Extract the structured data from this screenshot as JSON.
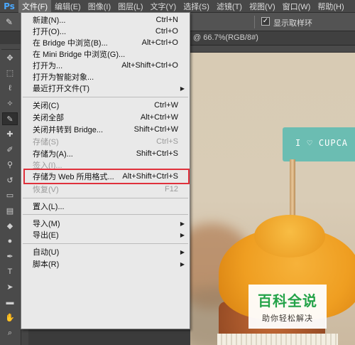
{
  "app": {
    "logo": "Ps"
  },
  "menubar": {
    "items": [
      {
        "label": "文件(F)",
        "active": true
      },
      {
        "label": "编辑(E)"
      },
      {
        "label": "图像(I)"
      },
      {
        "label": "图层(L)"
      },
      {
        "label": "文字(Y)"
      },
      {
        "label": "选择(S)"
      },
      {
        "label": "滤镜(T)"
      },
      {
        "label": "视图(V)"
      },
      {
        "label": "窗口(W)"
      },
      {
        "label": "帮助(H)"
      }
    ]
  },
  "options": {
    "show_sampling_ring_label": "显示取样环",
    "show_sampling_ring_checked": true
  },
  "document": {
    "tab_label": "@ 66.7%(RGB/8#)",
    "close": "×"
  },
  "file_menu": {
    "items": [
      {
        "label": "新建(N)...",
        "shortcut": "Ctrl+N"
      },
      {
        "label": "打开(O)...",
        "shortcut": "Ctrl+O"
      },
      {
        "label": "在 Bridge 中浏览(B)...",
        "shortcut": "Alt+Ctrl+O"
      },
      {
        "label": "在 Mini Bridge 中浏览(G)...",
        "shortcut": ""
      },
      {
        "label": "打开为...",
        "shortcut": "Alt+Shift+Ctrl+O"
      },
      {
        "label": "打开为智能对象...",
        "shortcut": ""
      },
      {
        "label": "最近打开文件(T)",
        "shortcut": "",
        "submenu": true
      },
      {
        "label": "关闭(C)",
        "shortcut": "Ctrl+W"
      },
      {
        "label": "关闭全部",
        "shortcut": "Alt+Ctrl+W"
      },
      {
        "label": "关闭并转到 Bridge...",
        "shortcut": "Shift+Ctrl+W"
      },
      {
        "label": "存储(S)",
        "shortcut": "Ctrl+S",
        "disabled": true
      },
      {
        "label": "存储为(A)...",
        "shortcut": "Shift+Ctrl+S"
      },
      {
        "label": "签入(I)...",
        "shortcut": "",
        "disabled": true
      },
      {
        "label": "存储为 Web 所用格式...",
        "shortcut": "Alt+Shift+Ctrl+S",
        "highlighted": true
      },
      {
        "label": "恢复(V)",
        "shortcut": "F12",
        "disabled": true
      },
      {
        "label": "置入(L)...",
        "shortcut": ""
      },
      {
        "label": "导入(M)",
        "shortcut": "",
        "submenu": true
      },
      {
        "label": "导出(E)",
        "shortcut": "",
        "submenu": true
      },
      {
        "label": "自动(U)",
        "shortcut": "",
        "submenu": true
      },
      {
        "label": "脚本(R)",
        "shortcut": "",
        "submenu": true
      }
    ],
    "submenu_arrow": "▶"
  },
  "canvas": {
    "flag_text": "I ♡ CUPCA"
  },
  "watermark": {
    "title": "百科全说",
    "subtitle": "助你轻松解决"
  },
  "colors": {
    "highlight_border": "#e0313c",
    "watermark_green": "#19a34a",
    "flag_teal": "#6bbdb2"
  },
  "tools": [
    "move-icon",
    "marquee-icon",
    "lasso-icon",
    "quick-select-icon",
    "eyedropper-icon",
    "healing-icon",
    "brush-icon",
    "stamp-icon",
    "history-brush-icon",
    "eraser-icon",
    "gradient-icon",
    "blur-icon",
    "dodge-icon",
    "pen-icon",
    "type-icon",
    "path-select-icon",
    "shape-icon",
    "hand-icon",
    "zoom-icon"
  ]
}
